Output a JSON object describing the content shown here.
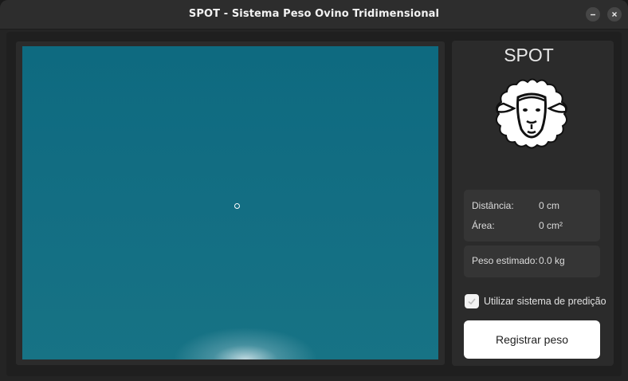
{
  "window": {
    "title": "SPOT - Sistema Peso Ovino Tridimensional",
    "minimize_icon": "minimize-icon",
    "close_icon": "close-icon"
  },
  "panel": {
    "app_name": "SPOT",
    "logo_icon": "sheep-icon",
    "metrics": [
      {
        "label": "Distância:",
        "value": "0 cm"
      },
      {
        "label": "Área:",
        "value": "0 cm²"
      }
    ],
    "weight": {
      "label": "Peso estimado:",
      "value": "0.0 kg"
    },
    "prediction_checkbox": {
      "label": "Utilizar sistema de predição",
      "checked": true
    },
    "register_button": "Registrar peso"
  },
  "colors": {
    "camera_teal": "#136e83",
    "panel_bg": "#2b2b2b",
    "box_bg": "#353535",
    "button_bg": "#ffffff"
  }
}
